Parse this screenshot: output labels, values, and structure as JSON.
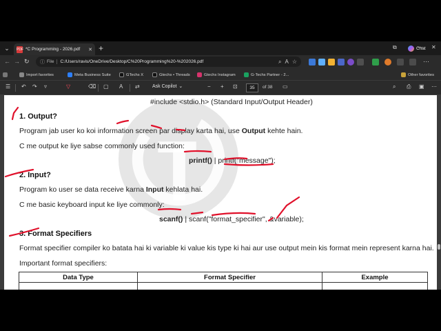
{
  "browser": {
    "tab_title": "*C Programming - 2026.pdf",
    "address_label": "File",
    "url": "C:/Users/ravis/OneDrive/Desktop/C%20Programming%20-%202026.pdf",
    "copilot_label": "Chat",
    "favorites": [
      "Import favorites",
      "Meta Business Suite",
      "GTechs X",
      "Gtechs • Threads",
      "Gtechs Instagram",
      "G-Techs Partner - 2...",
      "Other favorites"
    ]
  },
  "pdf_toolbar": {
    "ask_copilot": "Ask Copilot",
    "page_current": "35",
    "page_total": "of 38"
  },
  "document": {
    "include_line_code": "#include <stdio.h>",
    "include_line_rest": " (Standard Input/Output Header)",
    "sec1_heading": "1. Output?",
    "sec1_p1_a": "Program jab user ko koi information screen par display karta hai, use ",
    "sec1_p1_bold": "Output",
    "sec1_p1_b": " kehte hain.",
    "sec1_p2": "C me output ke liye sabse commonly used function:",
    "printf_bold": "printf()",
    "printf_rest": " | printf(\"message\");",
    "sec2_heading": "2. Input?",
    "sec2_p1_a": "Program ko user se data receive karna ",
    "sec2_p1_bold": "Input",
    "sec2_p1_b": " kehlata hai.",
    "sec2_p2": "C me basic keyboard input ke liye commonly:",
    "scanf_bold": "scanf()",
    "scanf_rest": " | scanf(\"format_specifier\", &variable);",
    "sec3_heading": "3. Format Specifiers",
    "sec3_p1": "Format specifier compiler ko batata hai ki variable ki value kis type ki hai aur use output mein kis format mein represent karna hai.",
    "sec3_p2": "Important format specifiers:",
    "table_headers": [
      "Data Type",
      "Format Specifier",
      "Example"
    ]
  },
  "colors": {
    "ink_red": "#e0102a",
    "watermark": "#8c8c8c"
  }
}
